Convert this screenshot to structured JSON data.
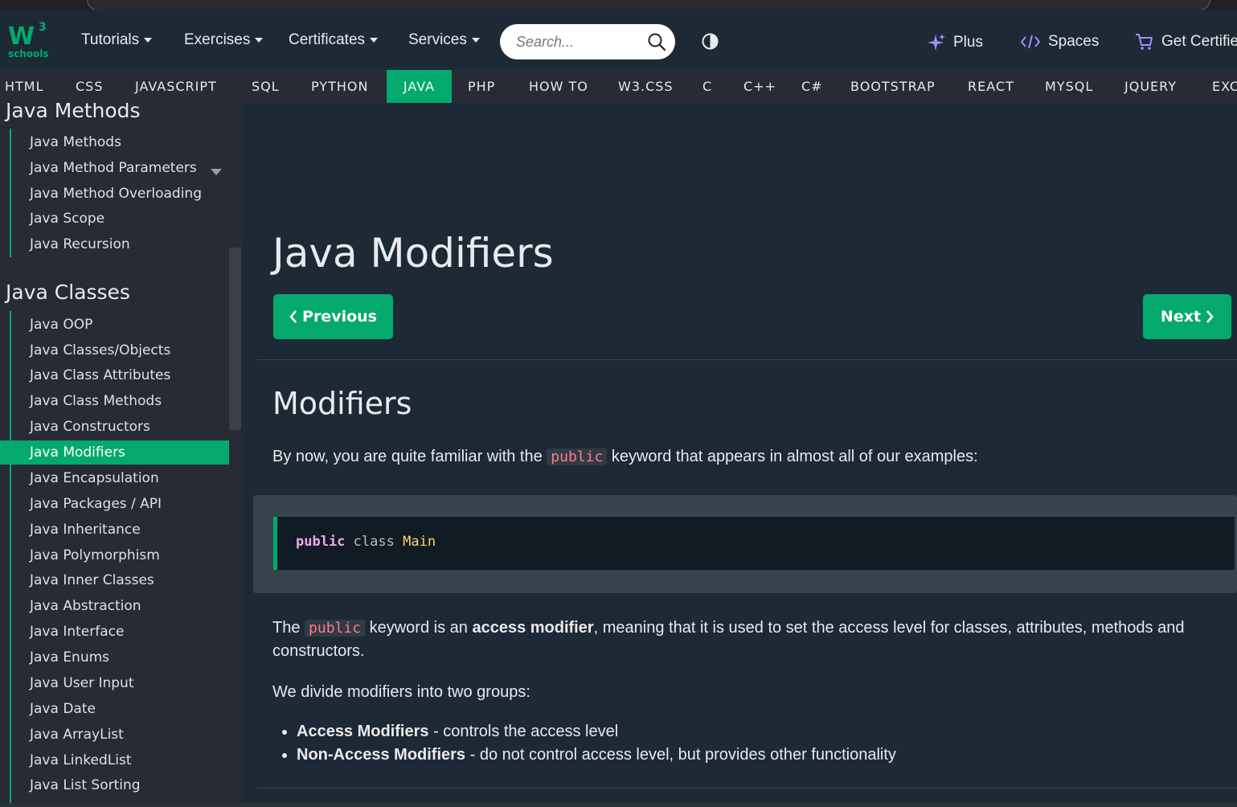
{
  "nav": {
    "logo_text": "W",
    "logo_superscript": "3",
    "logo_sub": "schools",
    "menus": [
      "Tutorials",
      "Exercises",
      "Certificates",
      "Services"
    ],
    "search_placeholder": "Search...",
    "plus_label": "Plus",
    "spaces_label": "Spaces",
    "certified_label": "Get Certifie"
  },
  "subjects": [
    "HTML",
    "CSS",
    "JAVASCRIPT",
    "SQL",
    "PYTHON",
    "JAVA",
    "PHP",
    "HOW TO",
    "W3.CSS",
    "C",
    "C++",
    "C#",
    "BOOTSTRAP",
    "REACT",
    "MYSQL",
    "JQUERY",
    "EXC"
  ],
  "active_subject": "JAVA",
  "sidebar": {
    "methods_heading": "Java Methods",
    "methods_items": [
      "Java Methods",
      "Java Method Parameters",
      "Java Method Overloading",
      "Java Scope",
      "Java Recursion"
    ],
    "classes_heading": "Java Classes",
    "classes_items": [
      "Java OOP",
      "Java Classes/Objects",
      "Java Class Attributes",
      "Java Class Methods",
      "Java Constructors",
      "Java Modifiers",
      "Java Encapsulation",
      "Java Packages / API",
      "Java Inheritance",
      "Java Polymorphism",
      "Java Inner Classes",
      "Java Abstraction",
      "Java Interface",
      "Java Enums",
      "Java User Input",
      "Java Date",
      "Java ArrayList",
      "Java LinkedList",
      "Java List Sorting"
    ],
    "active_item": "Java Modifiers"
  },
  "main": {
    "title": "Java Modifiers",
    "prev_label": "Previous",
    "next_label": "Next",
    "section_heading": "Modifiers",
    "intro_before": "By now, you are quite familiar with the ",
    "intro_keyword": "public",
    "intro_after": " keyword that appears in almost all of our examples:",
    "code": {
      "keyword": "public",
      "class_kw": "class",
      "name": "Main"
    },
    "p2_before": "The ",
    "p2_keyword": "public",
    "p2_middle": " keyword is an ",
    "p2_bold": "access modifier",
    "p2_after": ", meaning that it is used to set the access level for classes, attributes, methods and constructors.",
    "p3": "We divide modifiers into two groups:",
    "groups": [
      {
        "name": "Access Modifiers",
        "desc": " - controls the access level"
      },
      {
        "name": "Non-Access Modifiers",
        "desc": " - do not control access level, but provides other functionality"
      }
    ]
  },
  "colors": {
    "accent": "#04aa6d",
    "background": "#1d2a35",
    "sidebar": "#282a35"
  }
}
